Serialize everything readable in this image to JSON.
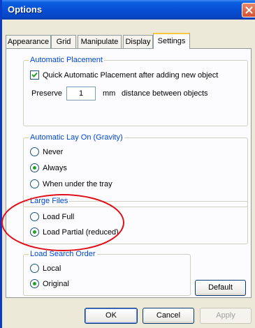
{
  "window": {
    "title": "Options"
  },
  "tabs": [
    {
      "label": "Appearance"
    },
    {
      "label": "Grid"
    },
    {
      "label": "Manipulate"
    },
    {
      "label": "Display"
    },
    {
      "label": "Settings",
      "active": true
    }
  ],
  "automatic_placement": {
    "title": "Automatic Placement",
    "checkbox_label": "Quick Automatic Placement after adding new object",
    "checked": true,
    "preserve_label": "Preserve",
    "preserve_value": "1",
    "unit_label": "mm",
    "distance_label": "distance between objects"
  },
  "automatic_lay_on": {
    "title": "Automatic Lay On (Gravity)",
    "options": [
      {
        "label": "Never",
        "selected": false
      },
      {
        "label": "Always",
        "selected": true
      },
      {
        "label": "When under the tray",
        "selected": false
      }
    ]
  },
  "large_files": {
    "title": "Large Files",
    "options": [
      {
        "label": "Load Full",
        "selected": false
      },
      {
        "label": "Load Partial (reduced)",
        "selected": true
      }
    ]
  },
  "load_search_order": {
    "title": "Load Search Order",
    "options": [
      {
        "label": "Local",
        "selected": false
      },
      {
        "label": "Original",
        "selected": true
      }
    ]
  },
  "buttons": {
    "default": "Default",
    "ok": "OK",
    "cancel": "Cancel",
    "apply": "Apply"
  },
  "colors": {
    "titlebar": "#0850d5",
    "group_title": "#0046d5",
    "highlight": "#e0101a"
  }
}
